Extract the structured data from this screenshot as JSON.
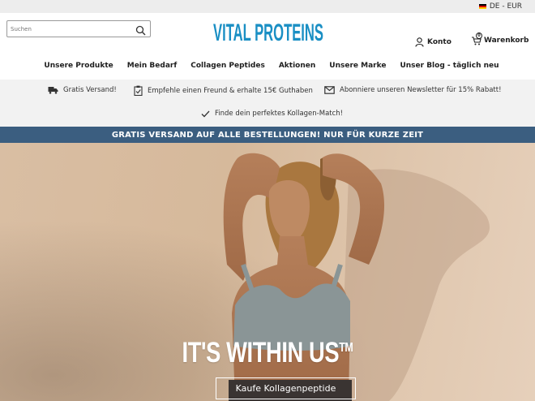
{
  "topbar": {
    "locale": "DE - EUR"
  },
  "header": {
    "search_placeholder": "Suchen",
    "logo_text": "VITAL PROTEINS",
    "account_label": "Konto",
    "cart_label": "Warenkorb",
    "cart_count": "0"
  },
  "nav": {
    "items": [
      "Unsere Produkte",
      "Mein Bedarf",
      "Collagen Peptides",
      "Aktionen",
      "Unsere Marke",
      "Unser Blog - täglich neu"
    ]
  },
  "benefits": {
    "shipping": "Gratis Versand!",
    "referral": "Empfehle einen Freund & erhalte 15€ Guthaben",
    "newsletter": "Abonniere unseren Newsletter für 15% Rabatt!",
    "match": "Finde dein perfektes Kollagen-Match!"
  },
  "promo": {
    "text": "GRATIS VERSAND AUF ALLE BESTELLUNGEN! NUR FÜR KURZE ZEIT"
  },
  "hero": {
    "title": "IT'S WITHIN US",
    "trademark": "TM",
    "button_label": "Kaufe Kollagenpeptide"
  },
  "colors": {
    "brand_blue": "#1a8fc4",
    "promo_bar": "#3b5e80",
    "benefit_bar": "#f2f2f2"
  }
}
